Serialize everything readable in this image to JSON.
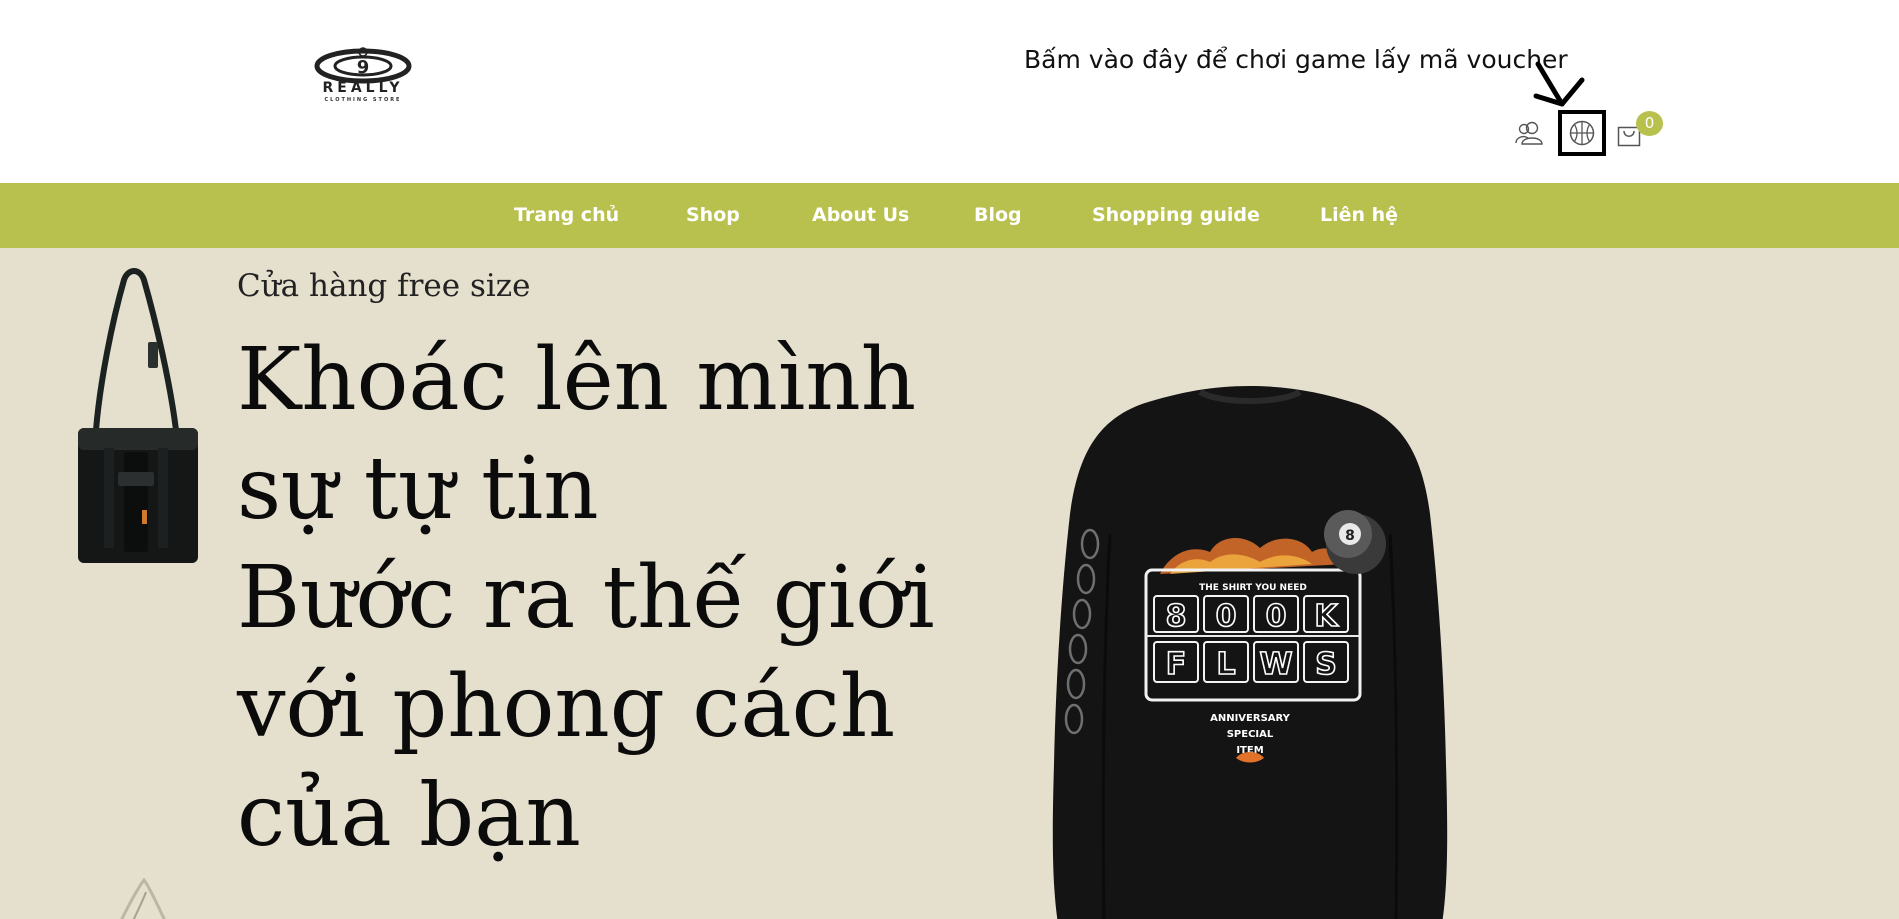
{
  "header": {
    "logo": {
      "brand_text": "REALLY",
      "tagline": "CLOTHING STORE",
      "emblem_number": "9"
    },
    "voucher_prompt": "Bấm vào đây để chơi game lấy mã voucher",
    "icons": {
      "user": "user-icon",
      "game": "basketball-icon",
      "cart": "shopping-bag-icon"
    },
    "cart_count": "0"
  },
  "nav": {
    "items": [
      {
        "label": "Trang chủ"
      },
      {
        "label": "Shop"
      },
      {
        "label": "About Us"
      },
      {
        "label": "Blog"
      },
      {
        "label": "Shopping guide"
      },
      {
        "label": "Liên hệ"
      }
    ]
  },
  "hero": {
    "subtitle": "Cửa hàng free size",
    "headline_lines": [
      "Khoác lên mình",
      "sự tự tin",
      "Bước ra thế giới",
      "với phong cách",
      "của bạn"
    ],
    "sweater_print": {
      "top_text": "THE SHIRT YOU NEED",
      "row1": [
        "8",
        "0",
        "0",
        "K"
      ],
      "row2": [
        "F",
        "L",
        "W",
        "S"
      ],
      "bottom_lines": [
        "ANNIVERSARY",
        "SPECIAL",
        "ITEM"
      ],
      "ball_number": "8"
    }
  },
  "colors": {
    "nav_background": "#b9c14e",
    "hero_background": "#e5dfcd",
    "cart_badge": "#b9c14e",
    "headline_text": "#0b0b0b"
  }
}
